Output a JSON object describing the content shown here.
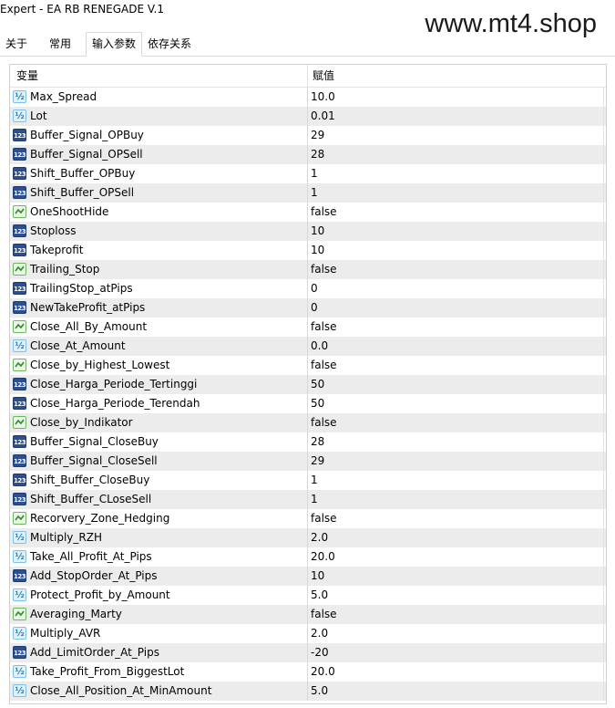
{
  "window": {
    "title": "Expert - EA RB RENEGADE V.1",
    "watermark": "www.mt4.shop"
  },
  "tabs": [
    {
      "label": "关于"
    },
    {
      "label": "常用"
    },
    {
      "label": "输入参数",
      "active": true
    },
    {
      "label": "依存关系"
    }
  ],
  "table": {
    "columns": [
      "变量",
      "赋值"
    ],
    "rows": [
      {
        "type": "double",
        "name": "Max_Spread",
        "value": "10.0"
      },
      {
        "type": "double",
        "name": "Lot",
        "value": "0.01"
      },
      {
        "type": "int",
        "name": "Buffer_Signal_OPBuy",
        "value": "29"
      },
      {
        "type": "int",
        "name": "Buffer_Signal_OPSell",
        "value": "28"
      },
      {
        "type": "int",
        "name": "Shift_Buffer_OPBuy",
        "value": "1"
      },
      {
        "type": "int",
        "name": "Shift_Buffer_OPSell",
        "value": "1"
      },
      {
        "type": "bool",
        "name": "OneShootHide",
        "value": "false"
      },
      {
        "type": "int",
        "name": "Stoploss",
        "value": "10"
      },
      {
        "type": "int",
        "name": "Takeprofit",
        "value": "10"
      },
      {
        "type": "bool",
        "name": "Trailing_Stop",
        "value": "false"
      },
      {
        "type": "int",
        "name": "TrailingStop_atPips",
        "value": "0"
      },
      {
        "type": "int",
        "name": "NewTakeProfit_atPips",
        "value": "0"
      },
      {
        "type": "bool",
        "name": "Close_All_By_Amount",
        "value": "false"
      },
      {
        "type": "double",
        "name": "Close_At_Amount",
        "value": "0.0"
      },
      {
        "type": "bool",
        "name": "Close_by_Highest_Lowest",
        "value": "false"
      },
      {
        "type": "int",
        "name": "Close_Harga_Periode_Tertinggi",
        "value": "50"
      },
      {
        "type": "int",
        "name": "Close_Harga_Periode_Terendah",
        "value": "50"
      },
      {
        "type": "bool",
        "name": "Close_by_Indikator",
        "value": "false"
      },
      {
        "type": "int",
        "name": "Buffer_Signal_CloseBuy",
        "value": "28"
      },
      {
        "type": "int",
        "name": "Buffer_Signal_CloseSell",
        "value": "29"
      },
      {
        "type": "int",
        "name": "Shift_Buffer_CloseBuy",
        "value": "1"
      },
      {
        "type": "int",
        "name": "Shift_Buffer_CLoseSell",
        "value": "1"
      },
      {
        "type": "bool",
        "name": "Recorvery_Zone_Hedging",
        "value": "false"
      },
      {
        "type": "double",
        "name": "Multiply_RZH",
        "value": "2.0"
      },
      {
        "type": "double",
        "name": "Take_All_Profit_At_Pips",
        "value": "20.0"
      },
      {
        "type": "int",
        "name": "Add_StopOrder_At_Pips",
        "value": "10"
      },
      {
        "type": "double",
        "name": "Protect_Profit_by_Amount",
        "value": "5.0"
      },
      {
        "type": "bool",
        "name": "Averaging_Marty",
        "value": "false"
      },
      {
        "type": "double",
        "name": "Multiply_AVR",
        "value": "2.0"
      },
      {
        "type": "int",
        "name": "Add_LimitOrder_At_Pips",
        "value": "-20"
      },
      {
        "type": "double",
        "name": "Take_Profit_From_BiggestLot",
        "value": "20.0"
      },
      {
        "type": "double",
        "name": "Close_All_Position_At_MinAmount",
        "value": "5.0"
      }
    ]
  },
  "icons": {
    "int": "integer-type-icon",
    "double": "double-type-icon",
    "bool": "boolean-type-icon"
  }
}
